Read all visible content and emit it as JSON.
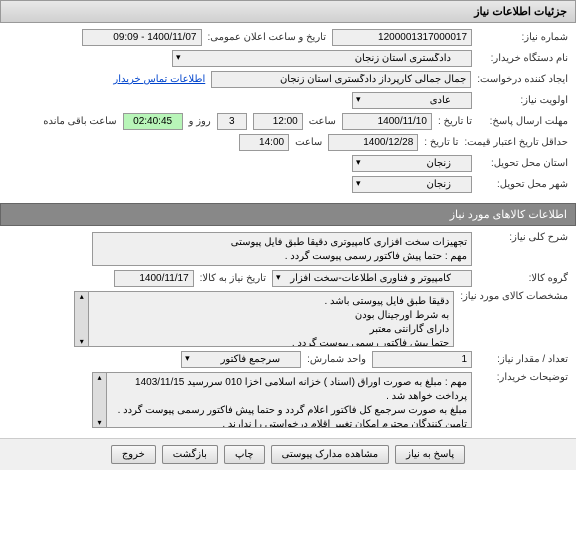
{
  "titlebar": "جزئیات اطلاعات نیاز",
  "fields": {
    "need_no_label": "شماره نیاز:",
    "need_no": "1200001317000017",
    "announce_label": "تاریخ و ساعت اعلان عمومی:",
    "announce_value": "1400/11/07 - 09:09",
    "buyer_label": "نام دستگاه خریدار:",
    "buyer_value": "دادگستری استان زنجان",
    "creator_label": "ایجاد کننده درخواست:",
    "creator_value": "جمال جمالی کارپرداز دادگستری استان زنجان",
    "contact_link": "اطلاعات تماس خریدار",
    "priority_label": "اولویت نیاز:",
    "priority_value": "عادی",
    "deadline_reply_label": "مهلت ارسال پاسخ:",
    "to_date_label": "تا تاریخ :",
    "deadline_date": "1400/11/10",
    "time_label": "ساعت",
    "deadline_time": "12:00",
    "days_remain": "3",
    "days_label": "روز و",
    "time_remain": "02:40:45",
    "remain_label": "ساعت باقی مانده",
    "min_validity_label": "حداقل تاریخ اعتبار قیمت:",
    "min_validity_date": "1400/12/28",
    "min_validity_time": "14:00",
    "delivery_province_label": "استان محل تحویل:",
    "delivery_province": "زنجان",
    "delivery_city_label": "شهر محل تحویل:",
    "delivery_city": "زنجان"
  },
  "section2_header": "اطلاعات کالاهای مورد نیاز",
  "goods": {
    "desc_label": "شرح کلی نیاز:",
    "desc_text": "تجهیزات سخت افزاری کامپیوتری دقیقا طبق فایل پیوستی\nمهم : حتما پیش فاکتور رسمی پیوست گردد .",
    "group_label": "گروه کالا:",
    "group_value": "کامپیوتر و فناوری اطلاعات-سخت افزار",
    "need_to_label": "تاریخ نیاز به کالا:",
    "need_to_date": "1400/11/17",
    "spec_label": "مشخصات کالای مورد نیاز:",
    "spec_text": "دقیقا طبق فایل پیوستی باشد .\nبه شرط اورجینال بودن\nدارای گارانتی معتبر\nحتما پیش فاکتور رسمی پیوست گردد .",
    "qty_label": "تعداد / مقدار نیاز:",
    "qty_value": "1",
    "unit_label": "واحد شمارش:",
    "unit_value": "سرجمع فاکتور",
    "buyer_notes_label": "توضیحات خریدار:",
    "buyer_notes_text": "مهم : مبلغ به صورت اوراق (اسناد ) خزانه اسلامی اخزا 010 سررسید 1403/11/15 پرداخت خواهد شد .\nمبلغ به صورت سرجمع کل فاکتور اعلام گردد و حتما پیش فاکتور رسمی پیوست گردد .\nتامین کنندگان محترم امکان تغییر اقلام درخواستی را ندارند ."
  },
  "buttons": {
    "reply": "پاسخ به نیاز",
    "attachments": "مشاهده مدارک پیوستی",
    "print": "چاپ",
    "back": "بازگشت",
    "exit": "خروج"
  }
}
